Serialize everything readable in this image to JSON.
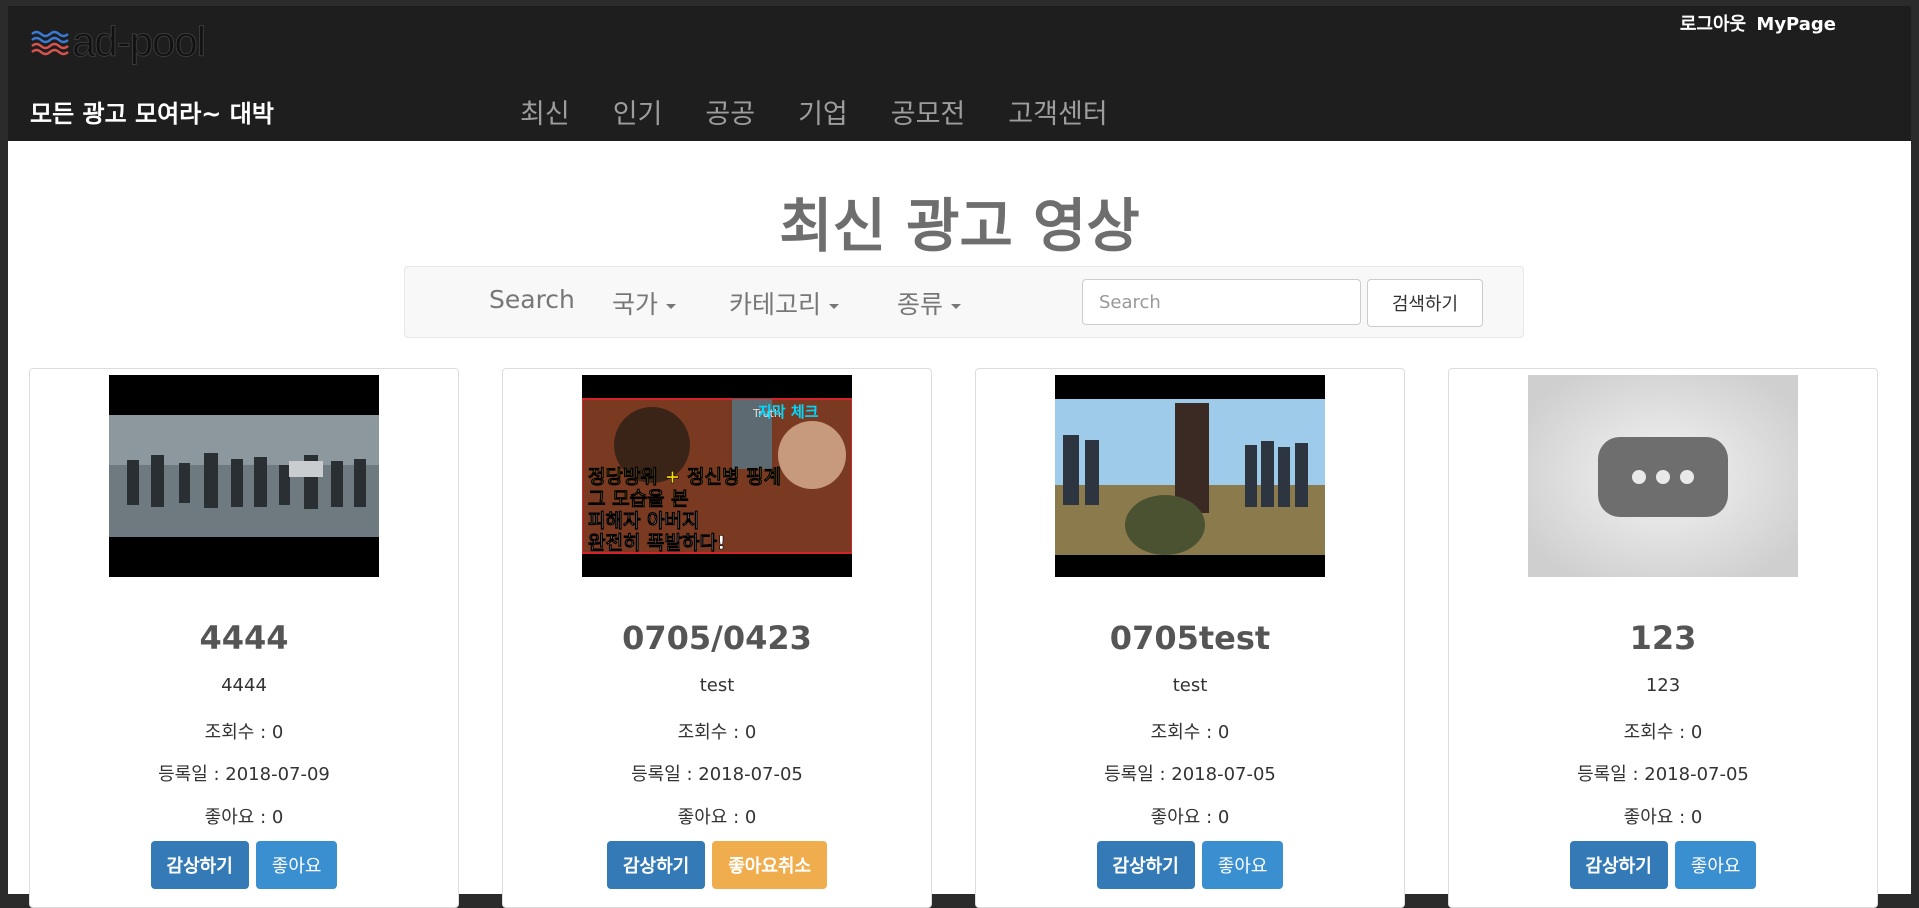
{
  "header": {
    "logo_text": "ad-pool",
    "tagline": "모든 광고 모여라~ 대박",
    "nav": [
      "최신",
      "인기",
      "공공",
      "기업",
      "공모전",
      "고객센터"
    ],
    "logout": "로그아웃",
    "mypage": "MyPage"
  },
  "page": {
    "title": "최신 광고 영상"
  },
  "search": {
    "label": "Search",
    "country": "국가",
    "category": "카테고리",
    "type": "종류",
    "placeholder": "Search",
    "button": "검색하기"
  },
  "cards": [
    {
      "title": "4444",
      "subtitle": "4444",
      "views": "조회수 : 0",
      "date": "등록일 : 2018-07-09",
      "likes": "좋아요 : 0",
      "watch": "감상하기",
      "like_btn": "좋아요"
    },
    {
      "title": "0705/0423",
      "subtitle": "test",
      "views": "조회수 : 0",
      "date": "등록일 : 2018-07-05",
      "likes": "좋아요 : 0",
      "watch": "감상하기",
      "like_btn": "좋아요취소",
      "thumb_text": {
        "top": "지막 체크",
        "line1": "정당방위 + 정신병 핑계",
        "line2": "그 모습을 본",
        "line3": "피해자 아버지",
        "line4": "완전히 폭발하다!",
        "truth": "Truth"
      }
    },
    {
      "title": "0705test",
      "subtitle": "test",
      "views": "조회수 : 0",
      "date": "등록일 : 2018-07-05",
      "likes": "좋아요 : 0",
      "watch": "감상하기",
      "like_btn": "좋아요"
    },
    {
      "title": "123",
      "subtitle": "123",
      "views": "조회수 : 0",
      "date": "등록일 : 2018-07-05",
      "likes": "좋아요 : 0",
      "watch": "감상하기",
      "like_btn": "좋아요"
    }
  ],
  "colors": {
    "primary": "#337ab7",
    "warning": "#f0ad4e",
    "header_bg": "#1e1e1e"
  }
}
